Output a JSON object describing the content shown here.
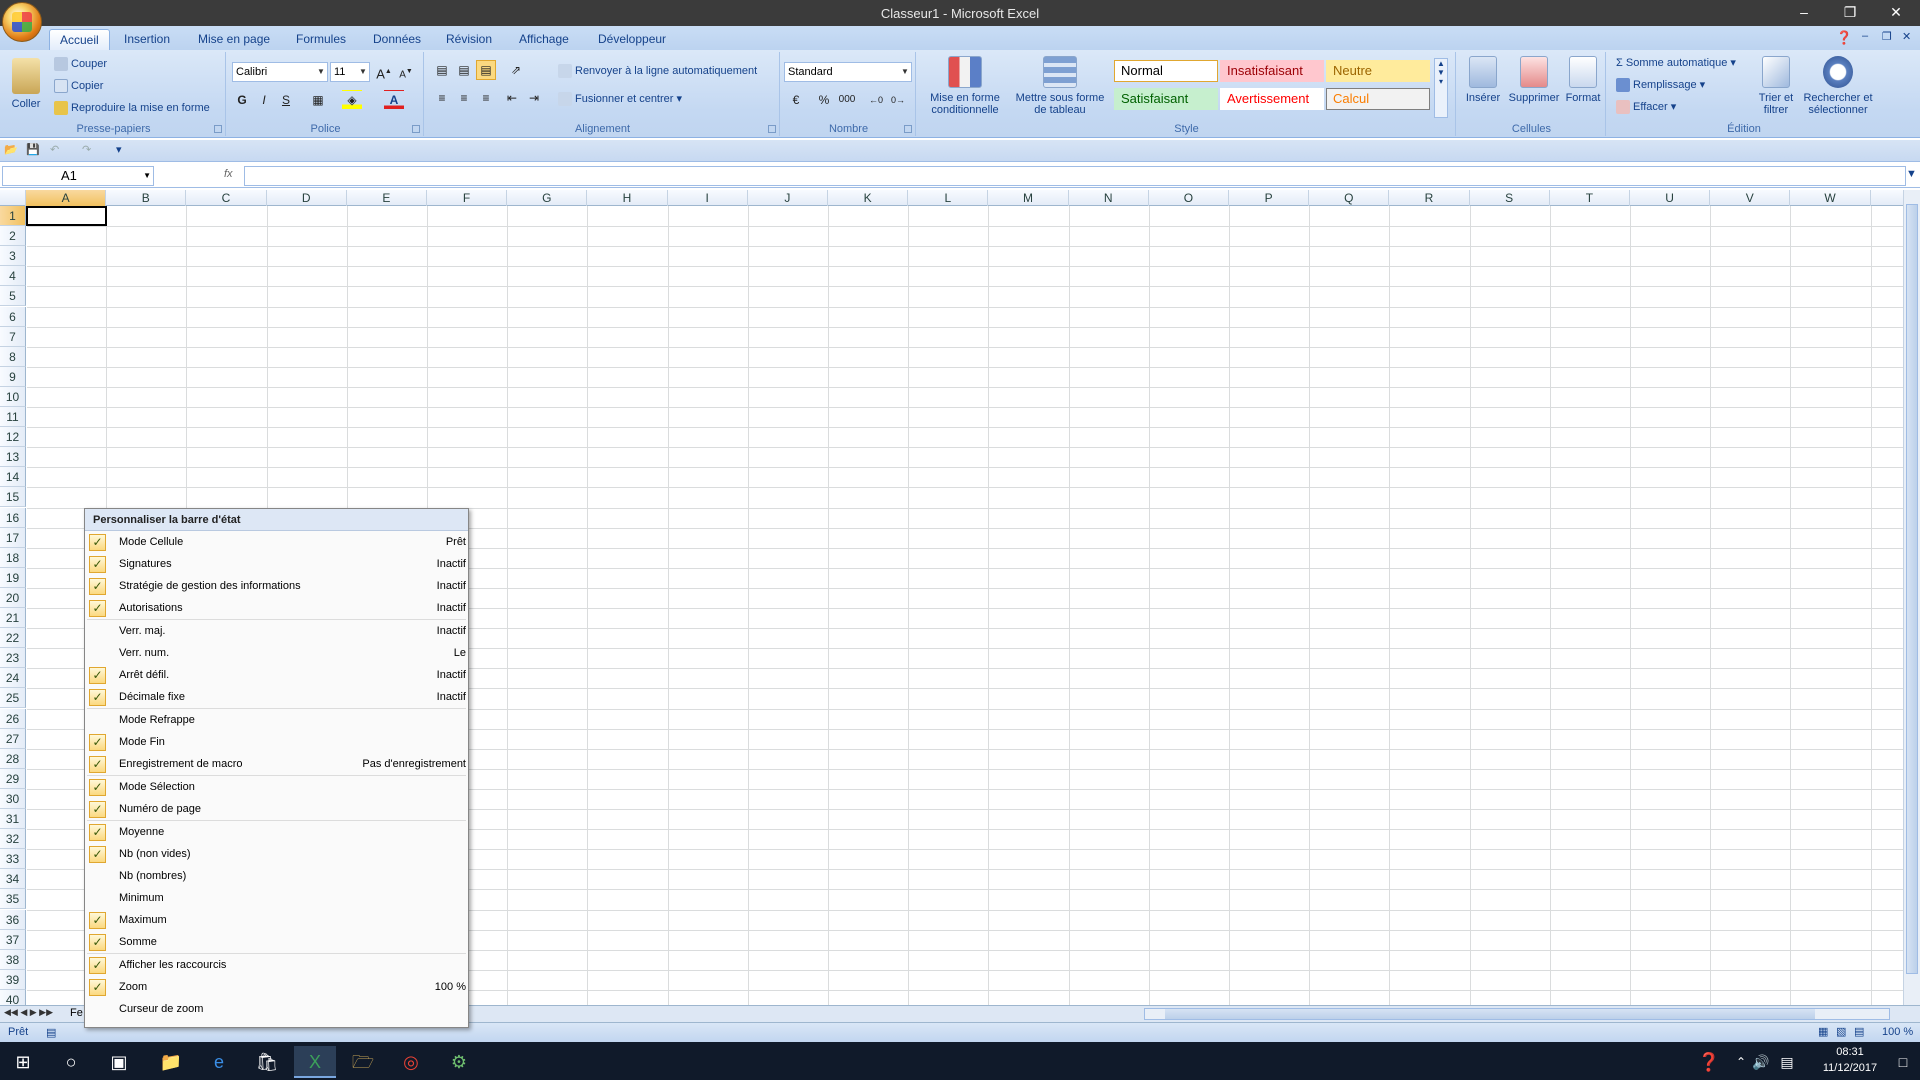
{
  "window": {
    "title": "Classeur1 - Microsoft Excel"
  },
  "tabs": [
    "Accueil",
    "Insertion",
    "Mise en page",
    "Formules",
    "Données",
    "Révision",
    "Affichage",
    "Développeur"
  ],
  "ribbon": {
    "clipboard": {
      "paste": "Coller",
      "cut": "Couper",
      "copy": "Copier",
      "format_painter": "Reproduire la mise en forme",
      "label": "Presse-papiers"
    },
    "font": {
      "name": "Calibri",
      "size": "11",
      "bold": "G",
      "italic": "I",
      "underline": "S",
      "label": "Police"
    },
    "alignment": {
      "wrap": "Renvoyer à la ligne automatiquement",
      "merge": "Fusionner et centrer",
      "label": "Alignement"
    },
    "number": {
      "format": "Standard",
      "percent": "%",
      "thousands": "000",
      "label": "Nombre"
    },
    "styles": {
      "cond_format": "Mise en forme conditionnelle",
      "table_format": "Mettre sous forme de tableau",
      "normal": "Normal",
      "bad": "Insatisfaisant",
      "neutral": "Neutre",
      "good": "Satisfaisant",
      "warning": "Avertissement",
      "calc": "Calcul",
      "label": "Style"
    },
    "cells": {
      "insert": "Insérer",
      "delete": "Supprimer",
      "format": "Format",
      "label": "Cellules"
    },
    "editing": {
      "autosum": "Somme automatique",
      "fill": "Remplissage",
      "clear": "Effacer",
      "sort": "Trier et filtrer",
      "find": "Rechercher et sélectionner",
      "label": "Édition"
    }
  },
  "formula_bar": {
    "name_box": "A1",
    "fx": "fx"
  },
  "columns": [
    "A",
    "B",
    "C",
    "D",
    "E",
    "F",
    "G",
    "H",
    "I",
    "J",
    "K",
    "L",
    "M",
    "N",
    "O",
    "P",
    "Q",
    "R",
    "S",
    "T",
    "U",
    "V",
    "W"
  ],
  "rows": [
    "1",
    "2",
    "3",
    "4",
    "5",
    "6",
    "7",
    "8",
    "9",
    "10",
    "11",
    "12",
    "13",
    "14",
    "15",
    "16",
    "17",
    "18",
    "19",
    "20",
    "21",
    "22",
    "23",
    "24",
    "25",
    "26",
    "27",
    "28",
    "29",
    "30",
    "31",
    "32",
    "33",
    "34",
    "35",
    "36",
    "37",
    "38",
    "39",
    "40"
  ],
  "sheet_tab": "Fe",
  "status": {
    "mode": "Prêt",
    "zoom": "100 %"
  },
  "context_menu": {
    "title": "Personnaliser la barre d'état",
    "items": [
      {
        "label": "Mode Cellule",
        "value": "Prêt",
        "checked": true
      },
      {
        "label": "Signatures",
        "value": "Inactif",
        "checked": true
      },
      {
        "label": "Stratégie de gestion des informations",
        "value": "Inactif",
        "checked": true
      },
      {
        "label": "Autorisations",
        "value": "Inactif",
        "checked": true
      },
      {
        "label": "Verr. maj.",
        "value": "Inactif",
        "checked": false
      },
      {
        "label": "Verr. num.",
        "value": "Le",
        "checked": false
      },
      {
        "label": "Arrêt défil.",
        "value": "Inactif",
        "checked": true
      },
      {
        "label": "Décimale fixe",
        "value": "Inactif",
        "checked": true
      },
      {
        "label": "Mode Refrappe",
        "value": "",
        "checked": false
      },
      {
        "label": "Mode Fin",
        "value": "",
        "checked": true
      },
      {
        "label": "Enregistrement de macro",
        "value": "Pas d'enregistrement",
        "checked": true
      },
      {
        "label": "Mode Sélection",
        "value": "",
        "checked": true
      },
      {
        "label": "Numéro de page",
        "value": "",
        "checked": true
      },
      {
        "label": "Moyenne",
        "value": "",
        "checked": true
      },
      {
        "label": "Nb (non vides)",
        "value": "",
        "checked": true
      },
      {
        "label": "Nb (nombres)",
        "value": "",
        "checked": false
      },
      {
        "label": "Minimum",
        "value": "",
        "checked": false
      },
      {
        "label": "Maximum",
        "value": "",
        "checked": true
      },
      {
        "label": "Somme",
        "value": "",
        "checked": true
      },
      {
        "label": "Afficher les raccourcis",
        "value": "",
        "checked": true
      },
      {
        "label": "Zoom",
        "value": "100 %",
        "checked": true
      },
      {
        "label": "Curseur de zoom",
        "value": "",
        "checked": false
      }
    ]
  },
  "taskbar": {
    "time": "08:31",
    "date": "11/12/2017"
  }
}
